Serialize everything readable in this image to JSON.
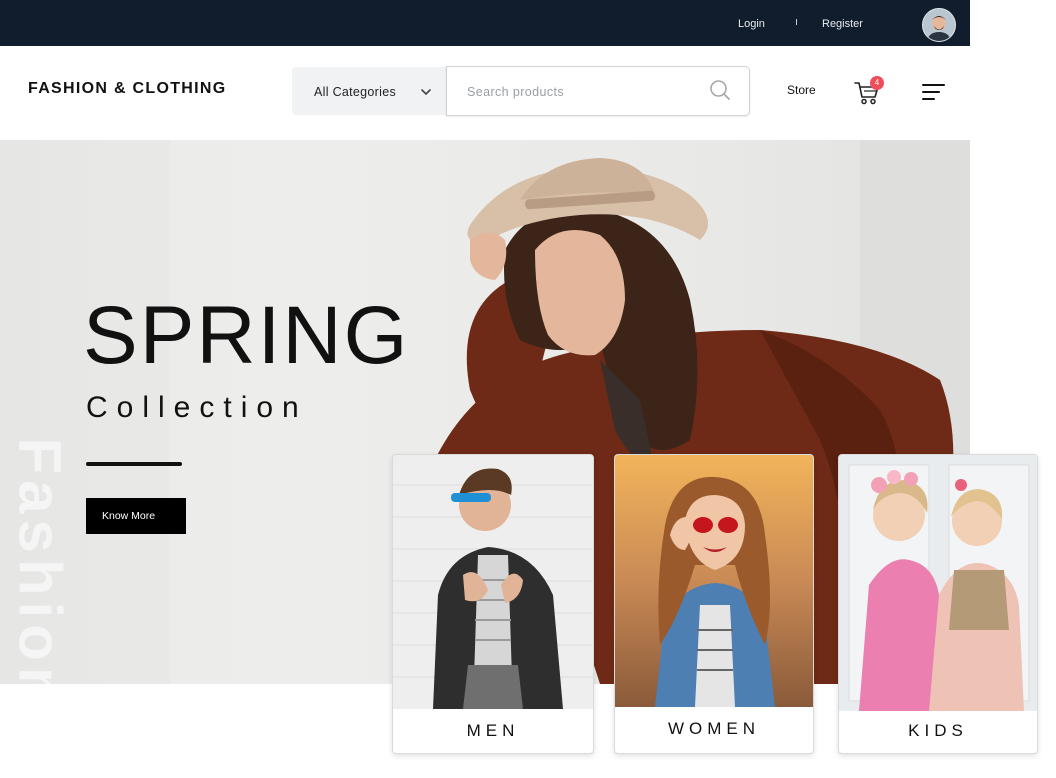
{
  "topbar": {
    "login": "Login",
    "register": "Register",
    "avatar_icon": "user-avatar"
  },
  "header": {
    "brand": "FASHION & CLOTHING",
    "category_select": {
      "selected": "All Categories"
    },
    "search": {
      "placeholder": "Search products",
      "value": ""
    },
    "store": "Store",
    "cart_count": "4"
  },
  "hero": {
    "vertical_text": "Fashion",
    "title": "SPRING",
    "subtitle": "Collection",
    "button": "Know More"
  },
  "categories": [
    {
      "label": "MEN"
    },
    {
      "label": "WOMEN"
    },
    {
      "label": "KIDS"
    }
  ],
  "colors": {
    "topbar": "#111c2c",
    "badge": "#ef4d5a",
    "coat": "#6e2a16",
    "hat": "#d8bfa8"
  }
}
